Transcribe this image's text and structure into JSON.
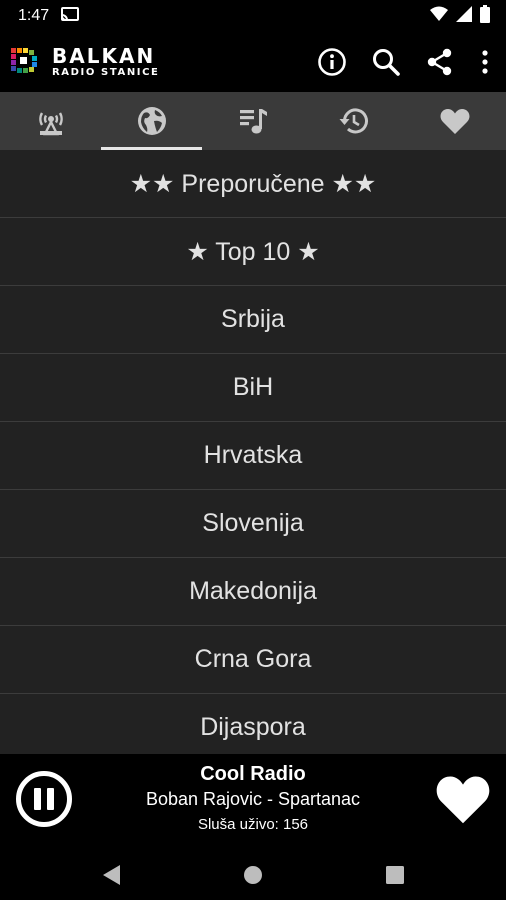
{
  "status_bar": {
    "time": "1:47",
    "icons": [
      "cast-icon",
      "wifi-icon",
      "signal-icon",
      "battery-icon"
    ]
  },
  "app_bar": {
    "logo_title": "BALKAN",
    "logo_subtitle": "RADIO STANICE",
    "actions": [
      "info-icon",
      "search-icon",
      "share-icon",
      "overflow-menu-icon"
    ]
  },
  "tabs": [
    {
      "icon": "radio-tower-icon",
      "active": false
    },
    {
      "icon": "globe-icon",
      "active": true
    },
    {
      "icon": "music-genre-icon",
      "active": false
    },
    {
      "icon": "history-icon",
      "active": false
    },
    {
      "icon": "heart-icon",
      "active": false
    }
  ],
  "list": {
    "items": [
      "★★ Preporučene ★★",
      "★ Top 10 ★",
      "Srbija",
      "BiH",
      "Hrvatska",
      "Slovenija",
      "Makedonija",
      "Crna Gora",
      "Dijaspora"
    ]
  },
  "player": {
    "station": "Cool Radio",
    "song": "Boban Rajovic - Spartanac",
    "listeners": "Sluša uživo: 156"
  },
  "colors": {
    "list_background": "#222222",
    "tab_background": "#3a3a3a",
    "divider": "#3c3c3c",
    "text": "#e2e2e2"
  }
}
